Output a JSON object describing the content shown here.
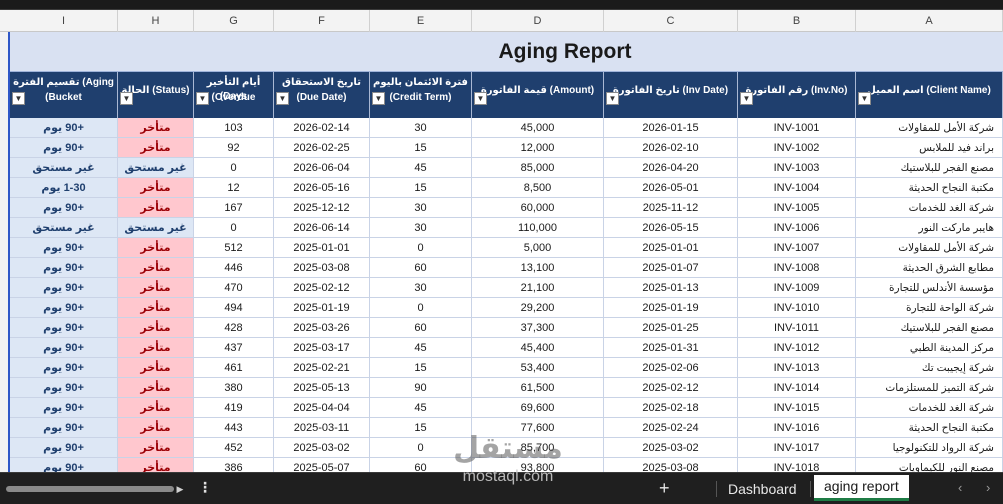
{
  "columns": [
    "I",
    "H",
    "G",
    "F",
    "E",
    "D",
    "C",
    "B",
    "A"
  ],
  "title": "Aging Report",
  "headers": {
    "bucket": [
      "تقسيم الفترة (Aging",
      "(Bucket"
    ],
    "status": [
      "الحالة (Status)"
    ],
    "overdue": [
      "أيام التأخير (Days",
      "(Overdue"
    ],
    "due_date": [
      "تاريخ الاستحقاق",
      "(Due Date)"
    ],
    "credit_term": [
      "فترة الائتمان باليوم",
      "(Credit Term)"
    ],
    "amount": [
      "قيمة الفاتورة (Amount)"
    ],
    "inv_date": [
      "تاريخ الفاتورة (Inv Date)"
    ],
    "inv_no": [
      "رقم الفاتورة (Inv.No)"
    ],
    "client": [
      "اسم العميل (Client Name)"
    ]
  },
  "rows": [
    {
      "bucket": "+90 يوم",
      "status": "متأخر",
      "overdue": "103",
      "due": "2026-02-14",
      "term": "30",
      "amount": "45,000",
      "inv_date": "2026-01-15",
      "inv": "INV-1001",
      "client": "شركة الأمل للمقاولات"
    },
    {
      "bucket": "+90 يوم",
      "status": "متأخر",
      "overdue": "92",
      "due": "2026-02-25",
      "term": "15",
      "amount": "12,000",
      "inv_date": "2026-02-10",
      "inv": "INV-1002",
      "client": "براند فيد للملابس"
    },
    {
      "bucket": "غير مستحق",
      "status": "غير مستحق",
      "overdue": "0",
      "due": "2026-06-04",
      "term": "45",
      "amount": "85,000",
      "inv_date": "2026-04-20",
      "inv": "INV-1003",
      "client": "مصنع الفجر للبلاستيك"
    },
    {
      "bucket": "1-30 يوم",
      "status": "متأخر",
      "overdue": "12",
      "due": "2026-05-16",
      "term": "15",
      "amount": "8,500",
      "inv_date": "2026-05-01",
      "inv": "INV-1004",
      "client": "مكتبة النجاح الحديثة"
    },
    {
      "bucket": "+90 يوم",
      "status": "متأخر",
      "overdue": "167",
      "due": "2025-12-12",
      "term": "30",
      "amount": "60,000",
      "inv_date": "2025-11-12",
      "inv": "INV-1005",
      "client": "شركة الغد للخدمات"
    },
    {
      "bucket": "غير مستحق",
      "status": "غير مستحق",
      "overdue": "0",
      "due": "2026-06-14",
      "term": "30",
      "amount": "110,000",
      "inv_date": "2026-05-15",
      "inv": "INV-1006",
      "client": "هايبر ماركت النور"
    },
    {
      "bucket": "+90 يوم",
      "status": "متأخر",
      "overdue": "512",
      "due": "2025-01-01",
      "term": "0",
      "amount": "5,000",
      "inv_date": "2025-01-01",
      "inv": "INV-1007",
      "client": "شركة الأمل للمقاولات"
    },
    {
      "bucket": "+90 يوم",
      "status": "متأخر",
      "overdue": "446",
      "due": "2025-03-08",
      "term": "60",
      "amount": "13,100",
      "inv_date": "2025-01-07",
      "inv": "INV-1008",
      "client": "مطابع الشرق الحديثة"
    },
    {
      "bucket": "+90 يوم",
      "status": "متأخر",
      "overdue": "470",
      "due": "2025-02-12",
      "term": "30",
      "amount": "21,100",
      "inv_date": "2025-01-13",
      "inv": "INV-1009",
      "client": "مؤسسة الأندلس للتجارة"
    },
    {
      "bucket": "+90 يوم",
      "status": "متأخر",
      "overdue": "494",
      "due": "2025-01-19",
      "term": "0",
      "amount": "29,200",
      "inv_date": "2025-01-19",
      "inv": "INV-1010",
      "client": "شركة الواحة للتجارة"
    },
    {
      "bucket": "+90 يوم",
      "status": "متأخر",
      "overdue": "428",
      "due": "2025-03-26",
      "term": "60",
      "amount": "37,300",
      "inv_date": "2025-01-25",
      "inv": "INV-1011",
      "client": "مصنع الفجر للبلاستيك"
    },
    {
      "bucket": "+90 يوم",
      "status": "متأخر",
      "overdue": "437",
      "due": "2025-03-17",
      "term": "45",
      "amount": "45,400",
      "inv_date": "2025-01-31",
      "inv": "INV-1012",
      "client": "مركز المدينة الطبي"
    },
    {
      "bucket": "+90 يوم",
      "status": "متأخر",
      "overdue": "461",
      "due": "2025-02-21",
      "term": "15",
      "amount": "53,400",
      "inv_date": "2025-02-06",
      "inv": "INV-1013",
      "client": "شركة إيجيبت تك"
    },
    {
      "bucket": "+90 يوم",
      "status": "متأخر",
      "overdue": "380",
      "due": "2025-05-13",
      "term": "90",
      "amount": "61,500",
      "inv_date": "2025-02-12",
      "inv": "INV-1014",
      "client": "شركة التميز للمستلزمات"
    },
    {
      "bucket": "+90 يوم",
      "status": "متأخر",
      "overdue": "419",
      "due": "2025-04-04",
      "term": "45",
      "amount": "69,600",
      "inv_date": "2025-02-18",
      "inv": "INV-1015",
      "client": "شركة الغد للخدمات"
    },
    {
      "bucket": "+90 يوم",
      "status": "متأخر",
      "overdue": "443",
      "due": "2025-03-11",
      "term": "15",
      "amount": "77,600",
      "inv_date": "2025-02-24",
      "inv": "INV-1016",
      "client": "مكتبة النجاح الحديثة"
    },
    {
      "bucket": "+90 يوم",
      "status": "متأخر",
      "overdue": "452",
      "due": "2025-03-02",
      "term": "0",
      "amount": "85,700",
      "inv_date": "2025-03-02",
      "inv": "INV-1017",
      "client": "شركة الرواد للتكنولوجيا"
    },
    {
      "bucket": "+90 يوم",
      "status": "متأخر",
      "overdue": "386",
      "due": "2025-05-07",
      "term": "60",
      "amount": "93,800",
      "inv_date": "2025-03-08",
      "inv": "INV-1018",
      "client": "مصنع النور للكيماويات"
    }
  ],
  "sheet_tabs": [
    "Dashboard",
    "aging report"
  ],
  "add_sheet_label": "+",
  "more_label": "⋮",
  "watermark": {
    "logo": "مستقل",
    "site": "mostaql.com"
  },
  "colors": {
    "header_bg": "#1f3f6e",
    "title_bg": "#d9e1f2",
    "late_bg": "#ffc7ce",
    "late_text": "#9c0006",
    "ok_bg": "#dde7f5"
  }
}
